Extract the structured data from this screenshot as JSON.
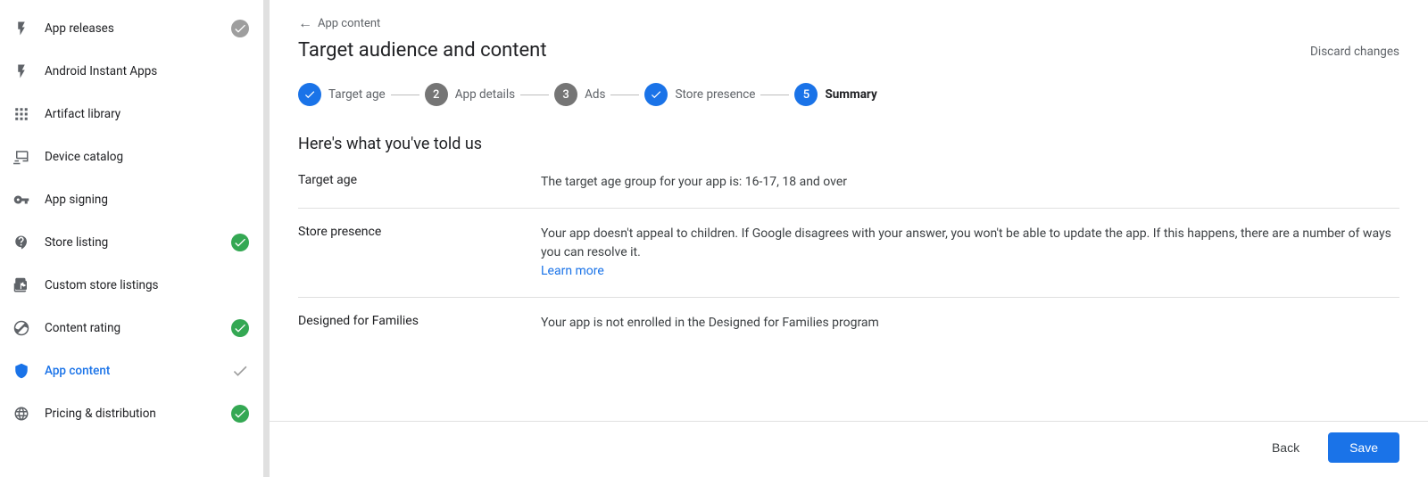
{
  "sidebar": {
    "items": [
      {
        "id": "app-releases",
        "label": "App releases",
        "icon": "⚡",
        "iconType": "lightning",
        "status": "grey-check",
        "active": false
      },
      {
        "id": "android-instant-apps",
        "label": "Android Instant Apps",
        "icon": "⚡",
        "iconType": "bolt",
        "status": null,
        "active": false
      },
      {
        "id": "artifact-library",
        "label": "Artifact library",
        "icon": "▦",
        "iconType": "grid",
        "status": null,
        "active": false
      },
      {
        "id": "device-catalog",
        "label": "Device catalog",
        "icon": "↩",
        "iconType": "device",
        "status": null,
        "active": false
      },
      {
        "id": "app-signing",
        "label": "App signing",
        "icon": "🔑",
        "iconType": "key",
        "status": null,
        "active": false
      },
      {
        "id": "store-listing",
        "label": "Store listing",
        "icon": "📋",
        "iconType": "store",
        "status": "green",
        "active": false
      },
      {
        "id": "custom-store-listings",
        "label": "Custom store listings",
        "icon": "📋",
        "iconType": "store2",
        "status": null,
        "active": false
      },
      {
        "id": "content-rating",
        "label": "Content rating",
        "icon": "©",
        "iconType": "rating",
        "status": "green",
        "active": false
      },
      {
        "id": "app-content",
        "label": "App content",
        "icon": "🛡",
        "iconType": "shield",
        "status": "grey-check",
        "active": true
      },
      {
        "id": "pricing-distribution",
        "label": "Pricing & distribution",
        "icon": "🌐",
        "iconType": "globe",
        "status": "green",
        "active": false
      }
    ]
  },
  "header": {
    "breadcrumb_arrow": "←",
    "breadcrumb_text": "App content",
    "page_title": "Target audience and content",
    "discard_label": "Discard changes"
  },
  "stepper": {
    "steps": [
      {
        "id": "target-age",
        "label": "Target age",
        "state": "completed",
        "symbol": "✓",
        "number": null
      },
      {
        "id": "app-details",
        "label": "App details",
        "state": "incomplete",
        "symbol": null,
        "number": "2"
      },
      {
        "id": "ads",
        "label": "Ads",
        "state": "incomplete",
        "symbol": null,
        "number": "3"
      },
      {
        "id": "store-presence",
        "label": "Store presence",
        "state": "completed",
        "symbol": "✓",
        "number": null
      },
      {
        "id": "summary",
        "label": "Summary",
        "state": "active",
        "symbol": null,
        "number": "5"
      }
    ]
  },
  "summary": {
    "heading": "Here's what you've told us",
    "rows": [
      {
        "key": "Target age",
        "value": "The target age group for your app is: 16-17, 18 and over",
        "has_link": false
      },
      {
        "key": "Store presence",
        "value": "Your app doesn't appeal to children. If Google disagrees with your answer, you won't be able to update the app. If this happens, there are a number of ways you can resolve it.",
        "link_text": "Learn more",
        "has_link": true
      },
      {
        "key": "Designed for Families",
        "value": "Your app is not enrolled in the Designed for Families program",
        "has_link": false
      }
    ]
  },
  "footer": {
    "back_label": "Back",
    "save_label": "Save"
  }
}
